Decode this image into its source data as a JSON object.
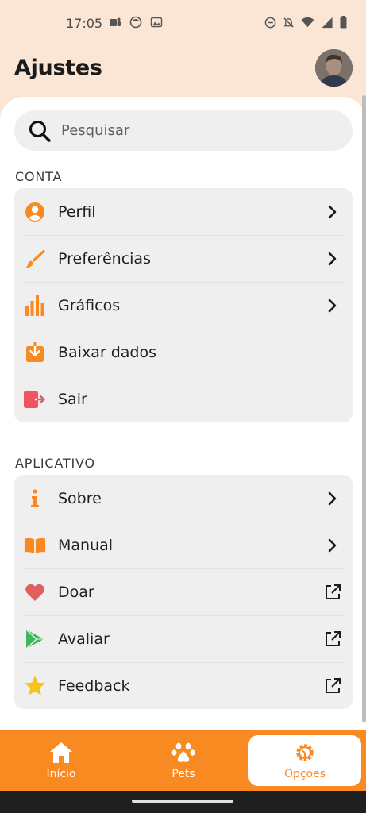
{
  "status_bar": {
    "time": "17:05",
    "left_icons": [
      "teams-icon",
      "emoji-icon",
      "image-icon"
    ],
    "right_icons": [
      "dnd-icon",
      "bell-off-icon",
      "wifi-icon",
      "signal-icon",
      "battery-icon"
    ]
  },
  "header": {
    "title": "Ajustes"
  },
  "search": {
    "placeholder": "Pesquisar"
  },
  "sections": {
    "account": {
      "label": "CONTA",
      "items": [
        {
          "label": "Perfil",
          "icon": "profile-icon",
          "trailing": "chevron-right-icon"
        },
        {
          "label": "Preferências",
          "icon": "brush-icon",
          "trailing": "chevron-right-icon"
        },
        {
          "label": "Gráficos",
          "icon": "chart-icon",
          "trailing": "chevron-right-icon"
        },
        {
          "label": "Baixar dados",
          "icon": "download-icon",
          "trailing": ""
        },
        {
          "label": "Sair",
          "icon": "logout-icon",
          "trailing": ""
        }
      ]
    },
    "app": {
      "label": "APLICATIVO",
      "items": [
        {
          "label": "Sobre",
          "icon": "info-icon",
          "trailing": "chevron-right-icon"
        },
        {
          "label": "Manual",
          "icon": "book-icon",
          "trailing": "chevron-right-icon"
        },
        {
          "label": "Doar",
          "icon": "heart-icon",
          "trailing": "external-link-icon"
        },
        {
          "label": "Avaliar",
          "icon": "play-store-icon",
          "trailing": "external-link-icon"
        },
        {
          "label": "Feedback",
          "icon": "star-icon",
          "trailing": "external-link-icon"
        }
      ]
    }
  },
  "bottom_nav": {
    "items": [
      {
        "label": "Início",
        "icon": "home-icon",
        "active": false
      },
      {
        "label": "Pets",
        "icon": "paw-icon",
        "active": false
      },
      {
        "label": "Opções",
        "icon": "settings-icon",
        "active": true
      }
    ]
  },
  "colors": {
    "accent": "#f98a22",
    "header_bg": "#fbe6d6",
    "card_bg": "#efefef",
    "logout": "#f0555f",
    "heart": "#e06060",
    "play": "#3fb55e",
    "star": "#f6c21c"
  }
}
